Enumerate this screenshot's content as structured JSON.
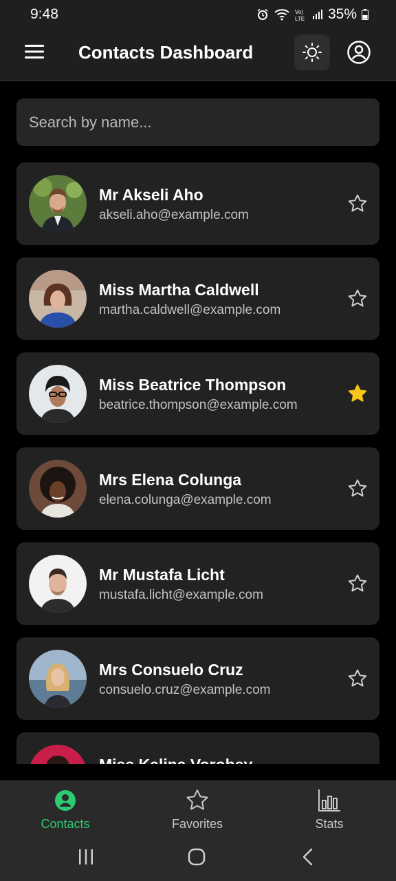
{
  "status": {
    "time": "9:48",
    "battery": "35%"
  },
  "app_bar": {
    "title": "Contacts Dashboard",
    "menu_icon": "menu-icon",
    "theme_icon": "sun-icon",
    "account_icon": "account-circle-icon"
  },
  "search": {
    "placeholder": "Search by name...",
    "value": ""
  },
  "contacts": [
    {
      "name": "Mr Akseli Aho",
      "email": "akseli.aho@example.com",
      "favorite": false
    },
    {
      "name": "Miss Martha Caldwell",
      "email": "martha.caldwell@example.com",
      "favorite": false
    },
    {
      "name": "Miss Beatrice Thompson",
      "email": "beatrice.thompson@example.com",
      "favorite": true
    },
    {
      "name": "Mrs Elena Colunga",
      "email": "elena.colunga@example.com",
      "favorite": false
    },
    {
      "name": "Mr Mustafa Licht",
      "email": "mustafa.licht@example.com",
      "favorite": false
    },
    {
      "name": "Mrs Consuelo Cruz",
      "email": "consuelo.cruz@example.com",
      "favorite": false
    },
    {
      "name": "Miss Kalina Vorobey",
      "email": "",
      "favorite": false
    }
  ],
  "bottom_nav": {
    "items": [
      {
        "label": "Contacts",
        "icon": "person-circle-icon",
        "active": true
      },
      {
        "label": "Favorites",
        "icon": "star-outline-icon",
        "active": false
      },
      {
        "label": "Stats",
        "icon": "bar-chart-icon",
        "active": false
      }
    ]
  },
  "colors": {
    "accent": "#2ecc71",
    "favorite": "#f5c518",
    "card": "#222222",
    "surface": "#1f1f1f"
  }
}
